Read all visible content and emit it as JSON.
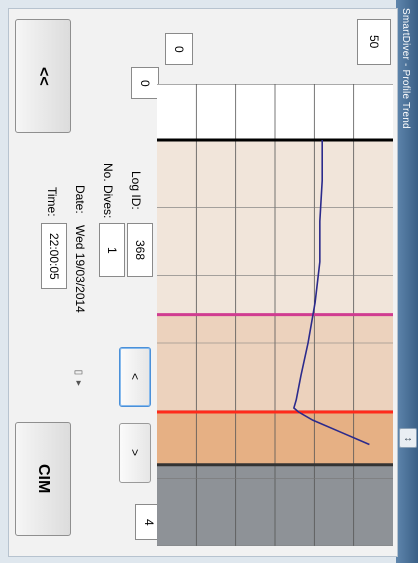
{
  "window": {
    "title": "SmartDiver - Profile Trend"
  },
  "controls": {
    "back_label": "<<",
    "cim_label": "CIM",
    "prev_label": "<",
    "next_label": ">",
    "range_left": "0",
    "range_mid": "0",
    "range_top": "50",
    "range_bottom": "4"
  },
  "info": {
    "log_id_label": "Log ID:",
    "log_id_value": "368",
    "dives_label": "No. Dives:",
    "dives_value": "1",
    "date_label": "Date:",
    "date_value": "Wed 19/03/2014",
    "time_label": "Time:",
    "time_value": "22:00:05"
  },
  "chart_data": {
    "type": "line",
    "zones": [
      {
        "from": 0.0,
        "to": 0.43,
        "color": "#f1e5da"
      },
      {
        "from": 0.43,
        "to": 0.67,
        "color": "#ecd2bd"
      },
      {
        "from": 0.67,
        "to": 0.8,
        "color": "#e6b084"
      },
      {
        "from": 0.8,
        "to": 1.0,
        "color": "#8e9297"
      }
    ],
    "markers": [
      {
        "pos": 0.0,
        "color": "#000000"
      },
      {
        "pos": 0.43,
        "color": "#d03c90"
      },
      {
        "pos": 0.67,
        "color": "#ff2a1a"
      },
      {
        "pos": 0.8,
        "color": "#333333"
      }
    ],
    "series": [
      {
        "color": "#2b2a8c",
        "x": [
          0.0,
          0.1,
          0.2,
          0.3,
          0.4,
          0.5,
          0.58,
          0.64,
          0.66,
          0.67,
          0.69,
          0.72,
          0.75
        ],
        "y": [
          0.7,
          0.7,
          0.69,
          0.69,
          0.67,
          0.64,
          0.61,
          0.59,
          0.58,
          0.6,
          0.66,
          0.78,
          0.9
        ]
      }
    ]
  },
  "colors": {
    "titlebar": "#4a739b",
    "focus": "#4a90d9"
  }
}
